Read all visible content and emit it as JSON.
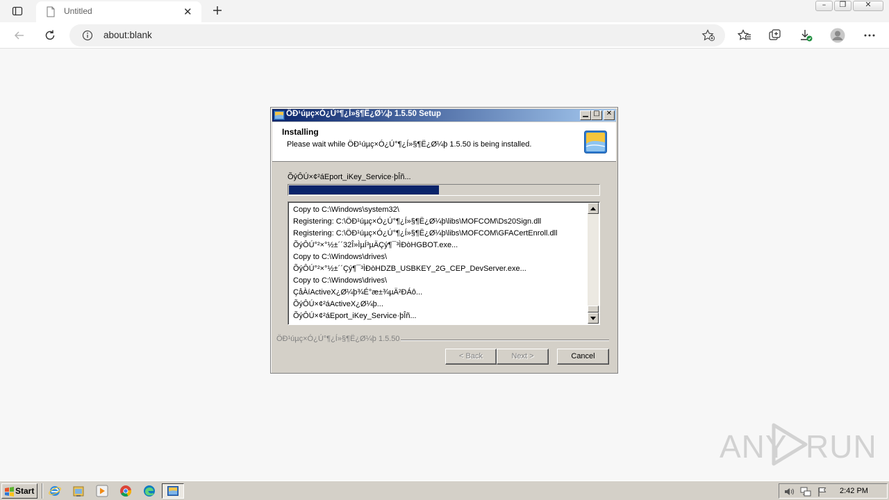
{
  "browser": {
    "tab_title": "Untitled",
    "address": "about:blank",
    "icons": {
      "tab_actions": "tab-actions-icon",
      "new_tab": "plus-icon",
      "back": "back-arrow-icon",
      "refresh": "refresh-icon",
      "site_info": "info-icon",
      "add_favorite": "star-plus-icon",
      "favorites": "favorites-icon",
      "collections": "collections-icon",
      "downloads": "download-icon",
      "profile": "avatar",
      "menu": "more-icon"
    }
  },
  "dialog": {
    "title": "ÖÐ¹úµç×Ó¿Ú°¶¿Í»§¶Ë¿Ø¼þ 1.5.50 Setup",
    "heading": "Installing",
    "subtext": "Please wait while ÖÐ¹úµç×Ó¿Ú°¶¿Í»§¶Ë¿Ø¼þ 1.5.50 is being installed.",
    "status": "ÕýÔÚ×¢²áEport_iKey_Service·þÎñ...",
    "progress_fraction": 0.485,
    "log": [
      "Copy to C:\\Windows\\system32\\",
      "Registering: C:\\ÖÐ¹úµç×Ó¿Ú°¶¿Í»§¶Ë¿Ø¼þ\\libs\\MOFCOM\\Ds20Sign.dll",
      "Registering: C:\\ÖÐ¹úµç×Ó¿Ú°¶¿Í»§¶Ë¿Ø¼þ\\libs\\MOFCOM\\GFACertEnroll.dll",
      "ÕýÔÚ°²×°½±´´32Î»ÌµÍ³µÄÇý¶¯³ÌÐòHGBOT.exe...",
      "Copy to C:\\Windows\\drives\\",
      "ÕýÔÚ°²×°½±´´Çý¶¯³ÌÐòHDZB_USBKEY_2G_CEP_DevServer.exe...",
      "Copy to C:\\Windows\\drives\\",
      "ÇåÀíActiveX¿Ø¼þ¾É°æ±¾µÄ²ÐÁô...",
      "ÕýÔÚ×¢²áActiveX¿Ø¼þ...",
      "ÕýÔÚ×¢²áEport_iKey_Service·þÎñ..."
    ],
    "branding": "ÖÐ¹úµç×Ó¿Ú°¶¿Í»§¶Ë¿Ø¼þ 1.5.50",
    "buttons": {
      "back": "< Back",
      "next": "Next >",
      "cancel": "Cancel"
    }
  },
  "watermark": {
    "left": "ANY",
    "right": "RUN"
  },
  "taskbar": {
    "start_label": "Start",
    "clock": "2:42 PM",
    "quicklaunch": [
      "ie-icon",
      "folder-icon",
      "media-player-icon",
      "chrome-icon",
      "edge-icon"
    ]
  },
  "colors": {
    "dialog_face": "#d4d0c8",
    "progress_fill": "#0a246a",
    "title_gradient_start": "#0a246a",
    "title_gradient_end": "#a6caf0"
  }
}
